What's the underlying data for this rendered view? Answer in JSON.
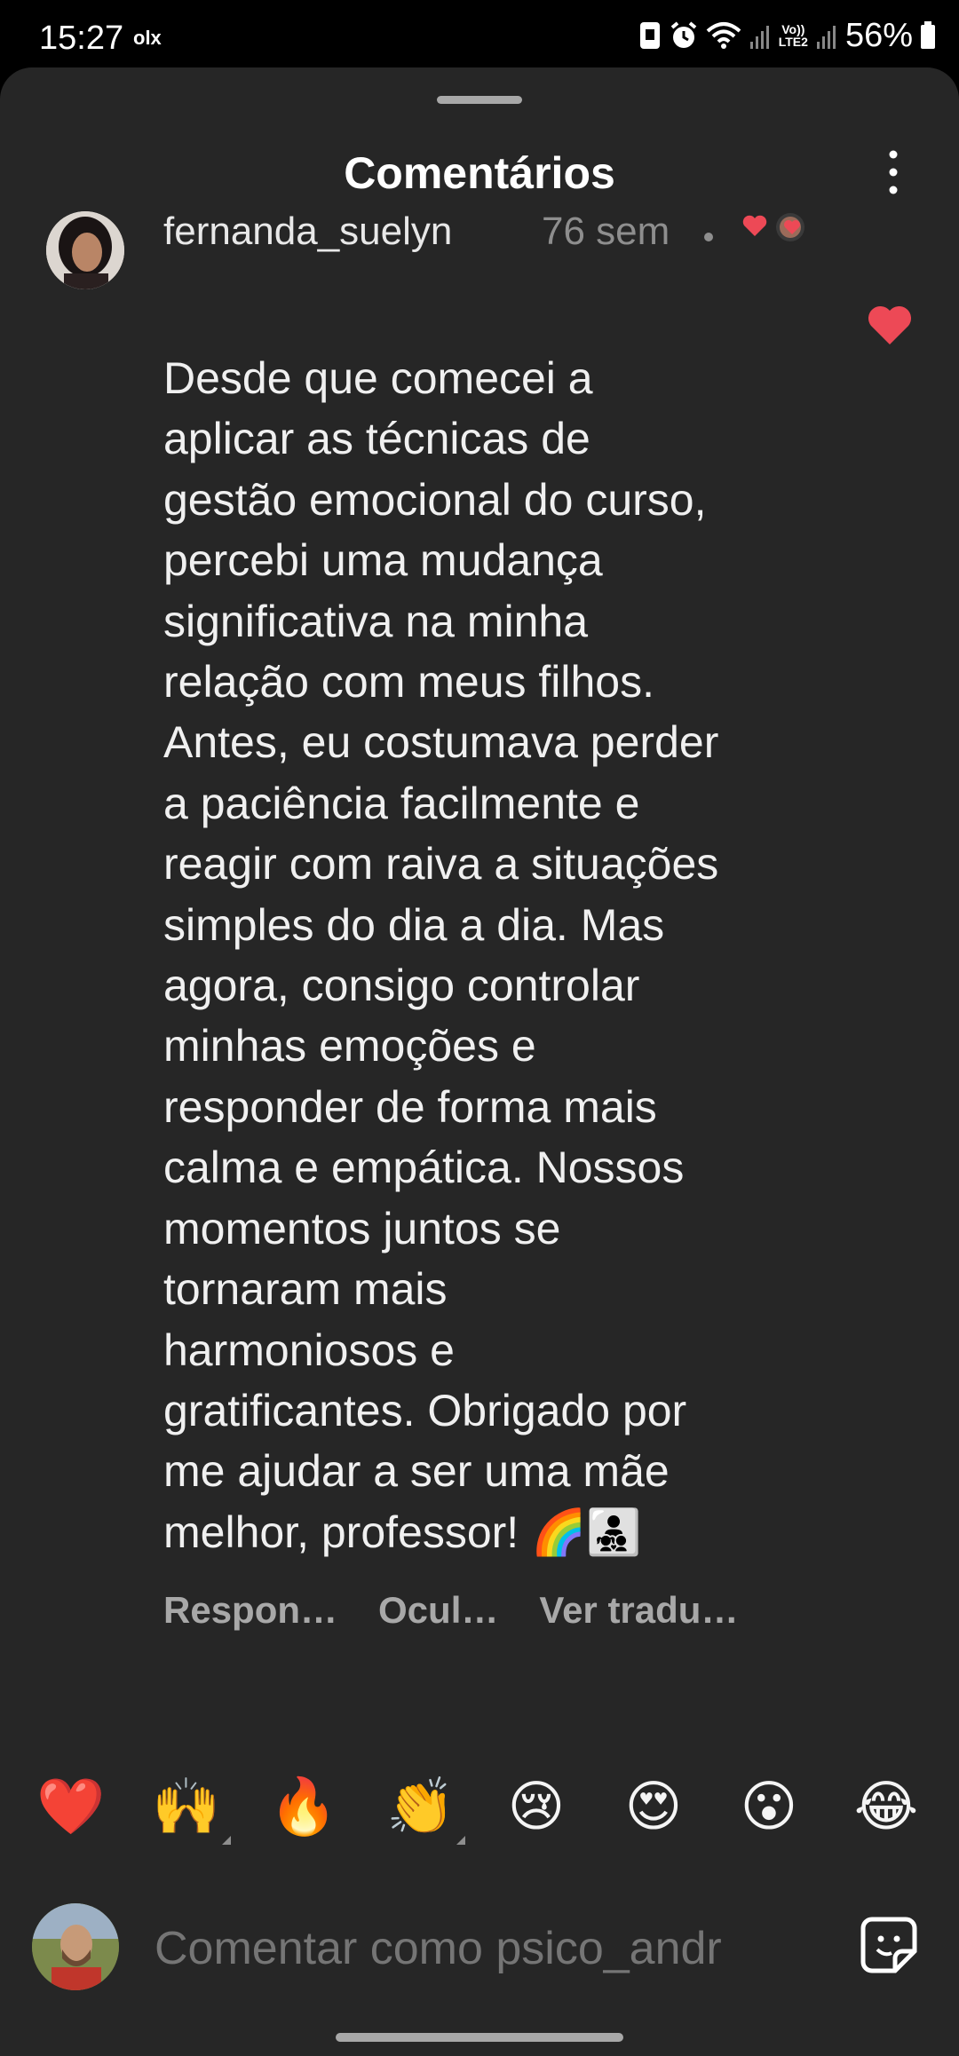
{
  "status_bar": {
    "time": "15:27",
    "app_badge": "olx",
    "volte_line1": "Vo))",
    "volte_line2": "LTE2",
    "battery_percent": "56%",
    "icons": [
      "app-notification-icon",
      "alarm-icon",
      "wifi-icon",
      "signal-icon",
      "signal-icon-2",
      "battery-icon"
    ]
  },
  "sheet": {
    "title": "Comentários",
    "more_icon": "more-vertical-icon"
  },
  "comment": {
    "username": "fernanda_suelyn",
    "time_ago": "76 sem",
    "creator_liked_icon": "creator-heart-badge-icon",
    "like_icon": "heart-filled-icon",
    "like_color": "#ed4956",
    "text": "Desde que comecei a\naplicar as técnicas de\ngestão emocional do curso,\npercebi uma mudança\nsignificativa na minha\nrelação com meus filhos.\nAntes, eu costumava perder\na paciência facilmente e\nreagir com raiva a situações\nsimples do dia a dia. Mas\nagora, consigo controlar\nminhas emoções e\nresponder de forma mais\ncalma e empática. Nossos\nmomentos juntos se\ntornaram mais\nharmoniosos e\ngratificantes. Obrigado por\nme ajudar a ser uma mãe\nmelhor, professor! 🌈👨‍👧‍👦",
    "actions": {
      "reply": "Respon…",
      "hide": "Ocul…",
      "translate": "Ver tradu…"
    }
  },
  "reactions": [
    "❤️",
    "🙌",
    "🔥",
    "👏",
    "😢",
    "😍",
    "😮",
    "😂"
  ],
  "composer": {
    "placeholder": "Comentar como psico_andr",
    "sticker_icon": "sticker-icon"
  }
}
